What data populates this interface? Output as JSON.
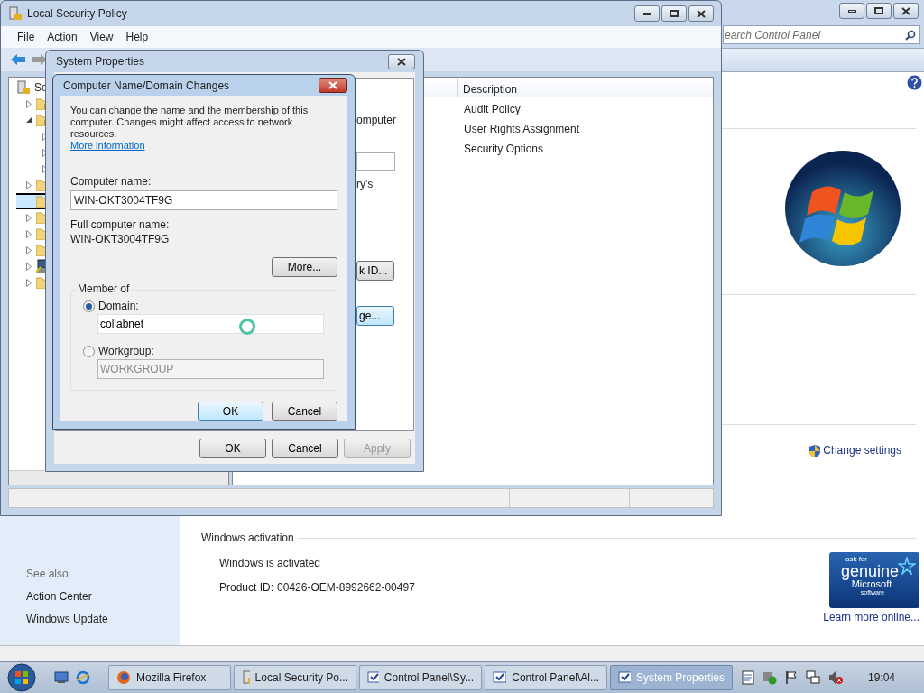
{
  "control_panel": {
    "search": {
      "placeholder": "earch Control Panel"
    },
    "see_also": {
      "heading": "See also",
      "links": [
        "Action Center",
        "Windows Update"
      ]
    },
    "change_settings": "Change settings",
    "activation": {
      "heading": "Windows activation",
      "status": "Windows is activated",
      "product_id_label": "Product ID:",
      "product_id": "00426-OEM-8992662-00497"
    },
    "genuine_badge": {
      "line_1": "ask for",
      "line_2": "genuine",
      "line_3": "Microsoft",
      "line_4": "software"
    },
    "learn_more": "Learn more online..."
  },
  "local_security_policy": {
    "title": "Local Security Policy",
    "menu": [
      "File",
      "Action",
      "View",
      "Help"
    ],
    "tree": [
      {
        "label": "Se",
        "kind": "policy",
        "selected": false,
        "children": [
          {
            "kind": "lock-folder",
            "expanded": false,
            "selected": false
          },
          {
            "kind": "lock-folder",
            "expanded": true,
            "selected": false,
            "children": [
              {
                "expanded": false,
                "selected": false
              },
              {
                "expanded": false,
                "selected": false
              },
              {
                "expanded": false,
                "selected": false
              }
            ]
          },
          {
            "kind": "folder",
            "expanded": false,
            "selected": false
          },
          {
            "kind": "folder",
            "selected": true
          },
          {
            "kind": "folder",
            "expanded": false,
            "selected": false
          },
          {
            "kind": "folder",
            "expanded": false,
            "selected": false
          },
          {
            "kind": "folder",
            "expanded": false,
            "selected": false
          },
          {
            "kind": "computer",
            "expanded": false,
            "selected": false
          },
          {
            "kind": "folder",
            "expanded": false,
            "selected": false
          }
        ]
      }
    ],
    "columns": [
      "Description"
    ],
    "rows": [
      "Audit Policy",
      "User Rights Assignment",
      "Security Options"
    ]
  },
  "system_properties": {
    "title": "System Properties",
    "visible_parts": [
      {
        "kind": "text",
        "text": "omputer"
      },
      {
        "kind": "field"
      },
      {
        "kind": "text",
        "text": "ry's"
      },
      {
        "kind": "button",
        "text": "k ID...",
        "default": false
      },
      {
        "kind": "button",
        "text": "ge...",
        "default": true
      }
    ],
    "buttons": [
      {
        "label": "OK",
        "disabled": false
      },
      {
        "label": "Cancel",
        "disabled": false
      },
      {
        "label": "Apply",
        "disabled": true
      }
    ]
  },
  "name_dialog": {
    "title": "Computer Name/Domain Changes",
    "intro": "You can change the name and the membership of this computer. Changes might affect access to network resources.",
    "link": "More information",
    "computer_name_label": "Computer name:",
    "computer_name": "WIN-OKT3004TF9G",
    "full_name_label": "Full computer name:",
    "full_name": "WIN-OKT3004TF9G",
    "more_button": "More...",
    "group_label": "Member of",
    "options": [
      {
        "label": "Domain:",
        "selected": true,
        "value": "collabnet"
      },
      {
        "label": "Workgroup:",
        "selected": false,
        "value": "WORKGROUP"
      }
    ],
    "buttons": [
      {
        "label": "OK",
        "default": true
      },
      {
        "label": "Cancel",
        "default": false
      }
    ]
  },
  "taskbar": {
    "buttons": [
      {
        "label": "Mozilla Firefox",
        "kind": "browser",
        "selected": false
      },
      {
        "label": "Local Security Po...",
        "kind": "policy",
        "selected": false
      },
      {
        "label": "Control Panel\\Sy...",
        "kind": "control-panel",
        "selected": false
      },
      {
        "label": "Control Panel\\Al...",
        "kind": "control-panel",
        "selected": false
      },
      {
        "label": "System Properties",
        "kind": "control-panel",
        "selected": true
      }
    ],
    "clock": "19:04"
  }
}
